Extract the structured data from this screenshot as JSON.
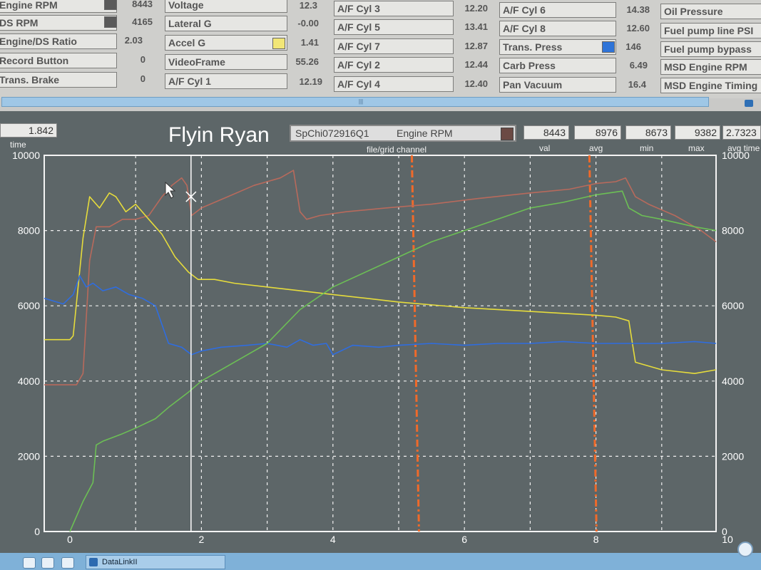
{
  "channel_panel": {
    "col1": [
      {
        "label": "Engine RPM",
        "value": "8443"
      },
      {
        "label": "DS RPM",
        "value": "4165"
      },
      {
        "label": "Engine/DS Ratio",
        "value": "2.03"
      },
      {
        "label": "Record Button",
        "value": "0"
      },
      {
        "label": "Trans. Brake",
        "value": "0"
      }
    ],
    "col2": [
      {
        "label": "Voltage",
        "value": "12.3"
      },
      {
        "label": "Lateral G",
        "value": "-0.00"
      },
      {
        "label": "Accel G",
        "value": "1.41"
      },
      {
        "label": "VideoFrame",
        "value": "55.26"
      },
      {
        "label": "A/F Cyl 1",
        "value": "12.19"
      }
    ],
    "col3": [
      {
        "label": "A/F Cyl 3",
        "value": "12.20"
      },
      {
        "label": "A/F Cyl 5",
        "value": "13.41"
      },
      {
        "label": "A/F Cyl 7",
        "value": "12.87"
      },
      {
        "label": "A/F Cyl 2",
        "value": "12.44"
      },
      {
        "label": "A/F Cyl 4",
        "value": "12.40"
      }
    ],
    "col4": [
      {
        "label": "A/F Cyl 6",
        "value": "14.38"
      },
      {
        "label": "A/F Cyl 8",
        "value": "12.60"
      },
      {
        "label": "Trans. Press",
        "value": "146"
      },
      {
        "label": "Carb Press",
        "value": "6.49"
      },
      {
        "label": "Pan Vacuum",
        "value": "16.4"
      }
    ],
    "col5": [
      {
        "label": "Oil Pressure"
      },
      {
        "label": "Fuel pump line PSI"
      },
      {
        "label": "Fuel pump bypass"
      },
      {
        "label": "MSD Engine RPM"
      },
      {
        "label": "MSD Engine Timing"
      }
    ],
    "swatch_colors": {
      "col1_row1": "#5a5a5a",
      "accel_g": "#f2e676",
      "trans_press": "#2f74d8"
    }
  },
  "scrollbar": {
    "thumb_glyph": "|||"
  },
  "readouts": {
    "time": {
      "value": "1.842",
      "caption": "time"
    },
    "title": "Flyin Ryan",
    "file_name": "SpChi072916Q1",
    "channel_name": "Engine RPM",
    "file_grid_caption": "file/grid channel",
    "val": {
      "value": "8443",
      "caption": "val"
    },
    "avg": {
      "value": "8976",
      "caption": "avg"
    },
    "min": {
      "value": "8673",
      "caption": "min"
    },
    "max": {
      "value": "9382",
      "caption": "max"
    },
    "avg_time": {
      "value": "2.7323",
      "caption": "avg time"
    }
  },
  "taskbar": {
    "app_label": "DataLinkII"
  },
  "chart_data": {
    "type": "line",
    "x_ticks": [
      "0",
      "2",
      "4",
      "6",
      "8",
      "10"
    ],
    "y_left_ticks": [
      "0",
      "2000",
      "4000",
      "6000",
      "8000",
      "10000"
    ],
    "y_right_ticks": [
      "0",
      "2000",
      "4000",
      "6000",
      "8000",
      "10000"
    ],
    "xlim": [
      0,
      10
    ],
    "ylim": [
      0,
      10000
    ],
    "grid": true,
    "cursor_x": 1.842,
    "markers_x": [
      5.2,
      7.9
    ],
    "colors": {
      "engine_rpm": "#b86a5c",
      "yellow": "#e6dc3c",
      "blue": "#2f6de0",
      "green": "#6cbf55",
      "marker": "#f06a2a"
    },
    "series": [
      {
        "color": "engine_rpm",
        "x": [
          -0.4,
          0,
          0.1,
          0.2,
          0.3,
          0.4,
          0.6,
          0.8,
          1.0,
          1.2,
          1.4,
          1.55,
          1.7,
          1.78,
          1.85,
          2.0,
          2.4,
          2.8,
          3.2,
          3.4,
          3.5,
          3.6,
          3.8,
          4.2,
          4.8,
          5.5,
          6.2,
          7.0,
          7.6,
          8.0,
          8.3,
          8.45,
          8.6,
          8.8,
          9.2,
          9.6,
          10.0
        ],
        "y": [
          3900,
          3900,
          3900,
          4200,
          7200,
          8100,
          8100,
          8300,
          8300,
          8400,
          8900,
          9200,
          9400,
          9200,
          8400,
          8600,
          8900,
          9200,
          9400,
          9600,
          8500,
          8300,
          8400,
          8500,
          8600,
          8700,
          8850,
          9000,
          9100,
          9250,
          9300,
          9400,
          8900,
          8700,
          8400,
          8000,
          7700
        ]
      },
      {
        "color": "yellow",
        "x": [
          -0.4,
          0,
          0.05,
          0.2,
          0.3,
          0.35,
          0.45,
          0.6,
          0.7,
          0.85,
          1.0,
          1.2,
          1.4,
          1.6,
          1.8,
          1.95,
          2.2,
          2.5,
          3.0,
          3.5,
          4.0,
          4.5,
          5.0,
          6.0,
          7.0,
          8.0,
          8.3,
          8.5,
          8.6,
          9.0,
          9.5,
          10.0
        ],
        "y": [
          5100,
          5100,
          5200,
          7800,
          8900,
          8800,
          8600,
          9000,
          8900,
          8500,
          8700,
          8300,
          7900,
          7300,
          6900,
          6700,
          6700,
          6600,
          6500,
          6400,
          6300,
          6200,
          6100,
          5950,
          5850,
          5750,
          5700,
          5600,
          4500,
          4300,
          4200,
          4300
        ]
      },
      {
        "color": "blue",
        "x": [
          -0.4,
          -0.2,
          -0.1,
          0.05,
          0.15,
          0.25,
          0.35,
          0.5,
          0.7,
          0.9,
          1.1,
          1.3,
          1.5,
          1.7,
          1.85,
          2.0,
          2.3,
          2.7,
          3.0,
          3.3,
          3.5,
          3.7,
          3.9,
          4.0,
          4.3,
          4.7,
          5.0,
          5.5,
          6.0,
          6.5,
          7.0,
          7.5,
          8.0,
          8.5,
          9.0,
          9.5,
          10.0
        ],
        "y": [
          6200,
          6100,
          6050,
          6300,
          6800,
          6500,
          6600,
          6400,
          6500,
          6300,
          6200,
          6000,
          5000,
          4900,
          4700,
          4800,
          4900,
          4950,
          5000,
          4900,
          5100,
          4950,
          5000,
          4700,
          4950,
          4900,
          4950,
          5000,
          4950,
          5000,
          5000,
          5050,
          5000,
          5000,
          5000,
          5050,
          5000
        ]
      },
      {
        "color": "green",
        "x": [
          0,
          0.2,
          0.35,
          0.4,
          0.5,
          0.8,
          1.0,
          1.3,
          1.5,
          1.8,
          2.0,
          2.5,
          3.0,
          3.5,
          4.0,
          4.5,
          5.0,
          5.5,
          6.0,
          6.5,
          7.0,
          7.5,
          8.0,
          8.4,
          8.5,
          8.7,
          9.0,
          9.5,
          10.0
        ],
        "y": [
          0,
          800,
          1300,
          2300,
          2400,
          2600,
          2750,
          3000,
          3300,
          3700,
          4000,
          4500,
          5000,
          5900,
          6500,
          6900,
          7300,
          7700,
          8000,
          8300,
          8600,
          8750,
          8950,
          9050,
          8600,
          8400,
          8300,
          8100,
          8000
        ]
      }
    ]
  }
}
